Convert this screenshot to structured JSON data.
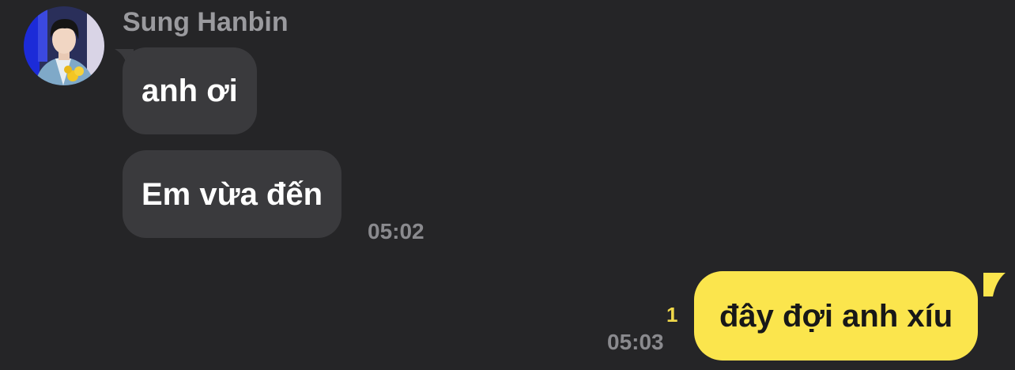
{
  "conversation": {
    "sender_name": "Sung Hanbin",
    "messages": [
      {
        "direction": "incoming",
        "text": "anh ơi"
      },
      {
        "direction": "incoming",
        "text": "Em vừa đến",
        "time": "05:02"
      },
      {
        "direction": "outgoing",
        "text": "đây đợi anh xíu",
        "time": "05:03",
        "unread_count": "1"
      }
    ]
  },
  "colors": {
    "background": "#252527",
    "incoming_bubble": "#3a3a3d",
    "outgoing_bubble": "#fbe54d",
    "unread_badge": "#f0d84a"
  },
  "icons": {
    "avatar": "contact-avatar-photo"
  }
}
